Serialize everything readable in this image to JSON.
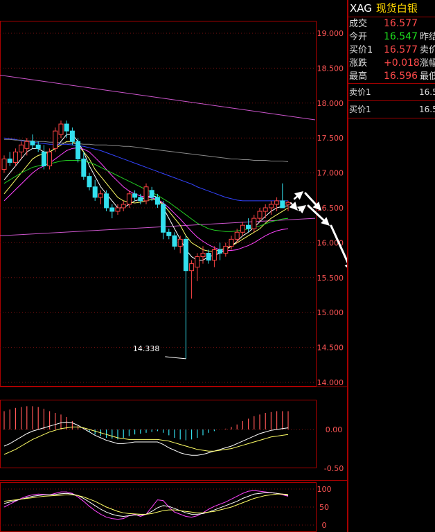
{
  "quote": {
    "symbol": "XAG",
    "name": "现货白银",
    "rows": [
      {
        "label": "成交",
        "value": "16.577",
        "color": "#ff4a4a",
        "label2": ""
      },
      {
        "label": "今开",
        "value": "16.547",
        "color": "#1ee11e",
        "label2": "昨结"
      },
      {
        "label": "买价1",
        "value": "16.577",
        "color": "#ff4a4a",
        "label2": "卖价"
      },
      {
        "label": "涨跌",
        "value": "+0.018",
        "color": "#ff4a4a",
        "label2": "涨幅"
      },
      {
        "label": "最高",
        "value": "16.596",
        "color": "#ff4a4a",
        "label2": "最低"
      }
    ],
    "book": [
      {
        "label": "卖价1",
        "value": "16.5"
      },
      {
        "label": "买价1",
        "value": "16.5"
      }
    ]
  },
  "chart_data": [
    {
      "type": "candlestick",
      "y_ticks": [
        "19.000",
        "18.500",
        "18.000",
        "17.500",
        "17.000",
        "16.500",
        "16.000",
        "15.500",
        "15.000",
        "14.500",
        "14.000"
      ],
      "ylim": [
        14.0,
        19.0
      ],
      "low_annotation": "14.338",
      "candles": [
        {
          "o": 17.05,
          "h": 17.25,
          "l": 17.0,
          "c": 17.2
        },
        {
          "o": 17.2,
          "h": 17.3,
          "l": 17.1,
          "c": 17.15
        },
        {
          "o": 17.15,
          "h": 17.35,
          "l": 17.1,
          "c": 17.3
        },
        {
          "o": 17.3,
          "h": 17.45,
          "l": 17.2,
          "c": 17.4
        },
        {
          "o": 17.35,
          "h": 17.5,
          "l": 17.25,
          "c": 17.45
        },
        {
          "o": 17.45,
          "h": 17.55,
          "l": 17.35,
          "c": 17.4
        },
        {
          "o": 17.4,
          "h": 17.45,
          "l": 17.3,
          "c": 17.35
        },
        {
          "o": 17.3,
          "h": 17.4,
          "l": 17.05,
          "c": 17.1
        },
        {
          "o": 17.1,
          "h": 17.35,
          "l": 17.05,
          "c": 17.3
        },
        {
          "o": 17.35,
          "h": 17.65,
          "l": 17.3,
          "c": 17.6
        },
        {
          "o": 17.55,
          "h": 17.75,
          "l": 17.5,
          "c": 17.7
        },
        {
          "o": 17.7,
          "h": 17.75,
          "l": 17.5,
          "c": 17.6
        },
        {
          "o": 17.6,
          "h": 17.65,
          "l": 17.4,
          "c": 17.45
        },
        {
          "o": 17.45,
          "h": 17.5,
          "l": 17.15,
          "c": 17.2
        },
        {
          "o": 17.2,
          "h": 17.3,
          "l": 16.9,
          "c": 16.95
        },
        {
          "o": 16.95,
          "h": 17.0,
          "l": 16.75,
          "c": 16.8
        },
        {
          "o": 16.8,
          "h": 16.9,
          "l": 16.6,
          "c": 16.65
        },
        {
          "o": 16.65,
          "h": 16.75,
          "l": 16.55,
          "c": 16.7
        },
        {
          "o": 16.7,
          "h": 16.75,
          "l": 16.45,
          "c": 16.5
        },
        {
          "o": 16.5,
          "h": 16.55,
          "l": 16.35,
          "c": 16.45
        },
        {
          "o": 16.45,
          "h": 16.55,
          "l": 16.4,
          "c": 16.5
        },
        {
          "o": 16.5,
          "h": 16.6,
          "l": 16.45,
          "c": 16.55
        },
        {
          "o": 16.55,
          "h": 16.75,
          "l": 16.5,
          "c": 16.7
        },
        {
          "o": 16.7,
          "h": 16.75,
          "l": 16.6,
          "c": 16.65
        },
        {
          "o": 16.65,
          "h": 16.7,
          "l": 16.55,
          "c": 16.6
        },
        {
          "o": 16.6,
          "h": 16.85,
          "l": 16.55,
          "c": 16.8
        },
        {
          "o": 16.75,
          "h": 16.8,
          "l": 16.6,
          "c": 16.65
        },
        {
          "o": 16.65,
          "h": 16.7,
          "l": 16.5,
          "c": 16.55
        },
        {
          "o": 16.55,
          "h": 16.6,
          "l": 16.05,
          "c": 16.15
        },
        {
          "o": 16.15,
          "h": 16.2,
          "l": 16.05,
          "c": 16.1
        },
        {
          "o": 16.1,
          "h": 16.15,
          "l": 15.9,
          "c": 15.95
        },
        {
          "o": 15.95,
          "h": 16.1,
          "l": 15.85,
          "c": 16.05
        },
        {
          "o": 16.05,
          "h": 16.1,
          "l": 14.338,
          "c": 15.6
        },
        {
          "o": 15.6,
          "h": 15.75,
          "l": 15.2,
          "c": 15.7
        },
        {
          "o": 15.65,
          "h": 15.85,
          "l": 15.45,
          "c": 15.8
        },
        {
          "o": 15.8,
          "h": 15.95,
          "l": 15.7,
          "c": 15.85
        },
        {
          "o": 15.85,
          "h": 15.9,
          "l": 15.7,
          "c": 15.75
        },
        {
          "o": 15.75,
          "h": 15.95,
          "l": 15.65,
          "c": 15.9
        },
        {
          "o": 15.9,
          "h": 16.0,
          "l": 15.75,
          "c": 15.85
        },
        {
          "o": 15.85,
          "h": 16.0,
          "l": 15.8,
          "c": 15.95
        },
        {
          "o": 15.95,
          "h": 16.1,
          "l": 15.9,
          "c": 16.05
        },
        {
          "o": 16.05,
          "h": 16.2,
          "l": 16.0,
          "c": 16.15
        },
        {
          "o": 16.15,
          "h": 16.3,
          "l": 16.1,
          "c": 16.25
        },
        {
          "o": 16.25,
          "h": 16.35,
          "l": 16.15,
          "c": 16.2
        },
        {
          "o": 16.2,
          "h": 16.4,
          "l": 16.15,
          "c": 16.35
        },
        {
          "o": 16.35,
          "h": 16.5,
          "l": 16.3,
          "c": 16.45
        },
        {
          "o": 16.45,
          "h": 16.55,
          "l": 16.35,
          "c": 16.5
        },
        {
          "o": 16.5,
          "h": 16.6,
          "l": 16.4,
          "c": 16.55
        },
        {
          "o": 16.55,
          "h": 16.65,
          "l": 16.45,
          "c": 16.6
        },
        {
          "o": 16.6,
          "h": 16.85,
          "l": 16.5,
          "c": 16.5
        },
        {
          "o": 16.55,
          "h": 16.6,
          "l": 16.45,
          "c": 16.577
        }
      ],
      "ma_lines": [
        {
          "color": "#ffffff",
          "values": [
            16.9,
            17.0,
            17.1,
            17.2,
            17.3,
            17.35,
            17.35,
            17.3,
            17.3,
            17.35,
            17.45,
            17.55,
            17.55,
            17.45,
            17.3,
            17.1,
            16.95,
            16.8,
            16.7,
            16.6,
            16.5,
            16.5,
            16.55,
            16.6,
            16.62,
            16.65,
            16.68,
            16.65,
            16.5,
            16.35,
            16.2,
            16.05,
            15.9,
            15.8,
            15.75,
            15.75,
            15.8,
            15.82,
            15.85,
            15.9,
            15.95,
            16.02,
            16.1,
            16.15,
            16.22,
            16.3,
            16.38,
            16.45,
            16.5,
            16.52,
            16.53
          ]
        },
        {
          "color": "#ffff66",
          "values": [
            16.7,
            16.8,
            16.9,
            17.0,
            17.1,
            17.2,
            17.25,
            17.27,
            17.3,
            17.35,
            17.4,
            17.45,
            17.45,
            17.4,
            17.3,
            17.2,
            17.05,
            16.95,
            16.85,
            16.75,
            16.65,
            16.6,
            16.58,
            16.57,
            16.58,
            16.6,
            16.62,
            16.62,
            16.55,
            16.45,
            16.35,
            16.25,
            16.1,
            16.0,
            15.95,
            15.9,
            15.88,
            15.88,
            15.9,
            15.92,
            15.95,
            16.0,
            16.05,
            16.1,
            16.15,
            16.2,
            16.28,
            16.35,
            16.4,
            16.45,
            16.5
          ]
        },
        {
          "color": "#ff44ff",
          "values": [
            16.6,
            16.68,
            16.76,
            16.84,
            16.92,
            17.0,
            17.06,
            17.1,
            17.14,
            17.2,
            17.26,
            17.32,
            17.35,
            17.36,
            17.34,
            17.3,
            17.22,
            17.14,
            17.05,
            16.96,
            16.88,
            16.8,
            16.74,
            16.7,
            16.67,
            16.65,
            16.64,
            16.62,
            16.57,
            16.5,
            16.42,
            16.34,
            16.25,
            16.16,
            16.08,
            16.02,
            15.97,
            15.93,
            15.9,
            15.89,
            15.89,
            15.9,
            15.93,
            15.96,
            16.0,
            16.05,
            16.1,
            16.14,
            16.17,
            16.19,
            16.2
          ]
        },
        {
          "color": "#22cc22",
          "values": [
            16.85,
            16.9,
            16.95,
            17.0,
            17.04,
            17.08,
            17.1,
            17.12,
            17.13,
            17.15,
            17.17,
            17.18,
            17.18,
            17.18,
            17.17,
            17.15,
            17.12,
            17.08,
            17.04,
            17.0,
            16.96,
            16.92,
            16.88,
            16.84,
            16.8,
            16.76,
            16.72,
            16.68,
            16.63,
            16.58,
            16.52,
            16.46,
            16.4,
            16.34,
            16.28,
            16.24,
            16.2,
            16.18,
            16.17,
            16.16,
            16.16,
            16.17,
            16.18,
            16.2,
            16.22,
            16.24,
            16.27,
            16.3,
            16.32,
            16.34,
            16.35
          ]
        },
        {
          "color": "#3344ff",
          "values": [
            17.5,
            17.49,
            17.48,
            17.46,
            17.45,
            17.44,
            17.43,
            17.42,
            17.41,
            17.41,
            17.41,
            17.41,
            17.4,
            17.39,
            17.38,
            17.36,
            17.34,
            17.32,
            17.29,
            17.26,
            17.23,
            17.2,
            17.17,
            17.14,
            17.11,
            17.08,
            17.05,
            17.02,
            16.99,
            16.96,
            16.93,
            16.9,
            16.87,
            16.84,
            16.8,
            16.77,
            16.74,
            16.71,
            16.68,
            16.65,
            16.63,
            16.61,
            16.6,
            16.6,
            16.6,
            16.6,
            16.6,
            16.6,
            16.6,
            16.6,
            16.6
          ]
        },
        {
          "color": "#888888",
          "values": [
            17.48,
            17.48,
            17.47,
            17.47,
            17.46,
            17.46,
            17.45,
            17.45,
            17.44,
            17.44,
            17.43,
            17.43,
            17.42,
            17.42,
            17.41,
            17.41,
            17.4,
            17.4,
            17.4,
            17.39,
            17.39,
            17.38,
            17.38,
            17.37,
            17.36,
            17.35,
            17.34,
            17.33,
            17.32,
            17.31,
            17.3,
            17.29,
            17.28,
            17.27,
            17.26,
            17.25,
            17.24,
            17.23,
            17.22,
            17.21,
            17.2,
            17.2,
            17.19,
            17.19,
            17.18,
            17.18,
            17.18,
            17.17,
            17.17,
            17.17,
            17.16
          ]
        }
      ],
      "long_lines": [
        {
          "color": "#cc55cc",
          "from": 18.4,
          "to": 17.76
        },
        {
          "color": "#cc55cc",
          "from": 16.1,
          "to": 16.35
        }
      ]
    },
    {
      "type": "bar",
      "y_ticks": [
        "0.00",
        "-0.50"
      ],
      "hist": [
        0.22,
        0.24,
        0.26,
        0.27,
        0.28,
        0.28,
        0.27,
        0.25,
        0.22,
        0.2,
        0.18,
        0.15,
        0.1,
        0.05,
        0.0,
        -0.03,
        -0.06,
        -0.08,
        -0.1,
        -0.11,
        -0.12,
        -0.1,
        -0.08,
        -0.06,
        -0.05,
        -0.04,
        -0.03,
        -0.02,
        -0.04,
        -0.07,
        -0.1,
        -0.12,
        -0.13,
        -0.12,
        -0.1,
        -0.07,
        -0.04,
        -0.02,
        0.0,
        0.01,
        0.03,
        0.06,
        0.1,
        0.13,
        0.16,
        0.18,
        0.2,
        0.21,
        0.22,
        0.22,
        0.22
      ],
      "lines": [
        {
          "color": "#ffffff",
          "values": [
            -0.2,
            -0.17,
            -0.13,
            -0.09,
            -0.05,
            -0.02,
            0.0,
            0.02,
            0.04,
            0.06,
            0.08,
            0.09,
            0.08,
            0.05,
            0.01,
            -0.03,
            -0.07,
            -0.1,
            -0.13,
            -0.15,
            -0.17,
            -0.17,
            -0.16,
            -0.15,
            -0.15,
            -0.15,
            -0.15,
            -0.15,
            -0.18,
            -0.22,
            -0.25,
            -0.28,
            -0.3,
            -0.31,
            -0.31,
            -0.3,
            -0.28,
            -0.26,
            -0.24,
            -0.22,
            -0.2,
            -0.17,
            -0.14,
            -0.11,
            -0.08,
            -0.05,
            -0.03,
            -0.01,
            0.0,
            0.01,
            0.02
          ]
        },
        {
          "color": "#ffff66",
          "values": [
            -0.3,
            -0.27,
            -0.24,
            -0.2,
            -0.16,
            -0.12,
            -0.09,
            -0.06,
            -0.03,
            -0.01,
            0.01,
            0.02,
            0.03,
            0.03,
            0.02,
            0.0,
            -0.02,
            -0.04,
            -0.06,
            -0.08,
            -0.1,
            -0.11,
            -0.12,
            -0.12,
            -0.12,
            -0.12,
            -0.12,
            -0.12,
            -0.13,
            -0.14,
            -0.16,
            -0.18,
            -0.2,
            -0.22,
            -0.24,
            -0.25,
            -0.26,
            -0.26,
            -0.25,
            -0.24,
            -0.23,
            -0.21,
            -0.19,
            -0.17,
            -0.15,
            -0.13,
            -0.11,
            -0.09,
            -0.08,
            -0.07,
            -0.06
          ]
        }
      ]
    },
    {
      "type": "line",
      "y_ticks": [
        "100",
        "50",
        "0"
      ],
      "ylim": [
        0,
        100
      ],
      "series": [
        {
          "color": "#ff44ff",
          "values": [
            50,
            58,
            66,
            74,
            80,
            84,
            86,
            85,
            84,
            88,
            92,
            92,
            88,
            78,
            66,
            52,
            40,
            30,
            22,
            18,
            16,
            18,
            26,
            30,
            24,
            30,
            50,
            70,
            68,
            50,
            36,
            30,
            24,
            22,
            26,
            34,
            44,
            52,
            58,
            64,
            72,
            80,
            88,
            94,
            96,
            94,
            92,
            90,
            88,
            84,
            80
          ]
        },
        {
          "color": "#ffffff",
          "values": [
            60,
            64,
            68,
            72,
            76,
            80,
            82,
            84,
            84,
            85,
            87,
            88,
            86,
            82,
            74,
            64,
            54,
            44,
            36,
            30,
            26,
            24,
            26,
            28,
            28,
            30,
            38,
            48,
            54,
            52,
            46,
            40,
            34,
            30,
            30,
            32,
            36,
            42,
            48,
            54,
            60,
            66,
            74,
            80,
            86,
            88,
            90,
            90,
            88,
            86,
            82
          ]
        },
        {
          "color": "#ffff66",
          "values": [
            66,
            68,
            70,
            72,
            74,
            76,
            78,
            80,
            81,
            82,
            83,
            84,
            84,
            82,
            78,
            72,
            66,
            58,
            50,
            44,
            38,
            34,
            32,
            31,
            30,
            30,
            32,
            36,
            40,
            42,
            42,
            40,
            38,
            36,
            34,
            34,
            36,
            38,
            42,
            46,
            50,
            56,
            62,
            68,
            74,
            78,
            82,
            84,
            86,
            86,
            85
          ]
        }
      ]
    }
  ]
}
